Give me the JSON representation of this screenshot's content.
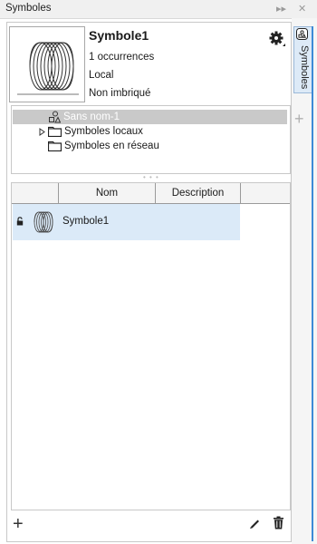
{
  "window": {
    "title": "Symboles",
    "collapse_glyph": "▸▸",
    "close_glyph": "✕"
  },
  "symbol_info": {
    "name": "Symbole1",
    "occurrences": "1 occurrences",
    "scope": "Local",
    "nesting": "Non imbriqué",
    "preview_icon": "coil-icon",
    "settings_icon": "gear-icon"
  },
  "tree": {
    "items": [
      {
        "label": "Sans nom-1",
        "icon": "document-shapes-icon",
        "selected": true
      },
      {
        "label": "Symboles locaux",
        "icon": "folder-icon",
        "expandable": true
      },
      {
        "label": "Symboles en réseau",
        "icon": "folder-icon",
        "expandable": false
      }
    ],
    "splitter_glyph": "• • •"
  },
  "table": {
    "columns": [
      "",
      "Nom",
      "Description",
      ""
    ],
    "rows": [
      {
        "name": "Symbole1",
        "description": "",
        "locked": true
      }
    ]
  },
  "footer": {
    "add_glyph": "+",
    "edit_icon": "pencil-icon",
    "delete_icon": "trash-icon"
  },
  "side_tabs": {
    "active_label": "Symboles",
    "add_glyph": "+",
    "accent_color": "#3d8ad6"
  }
}
